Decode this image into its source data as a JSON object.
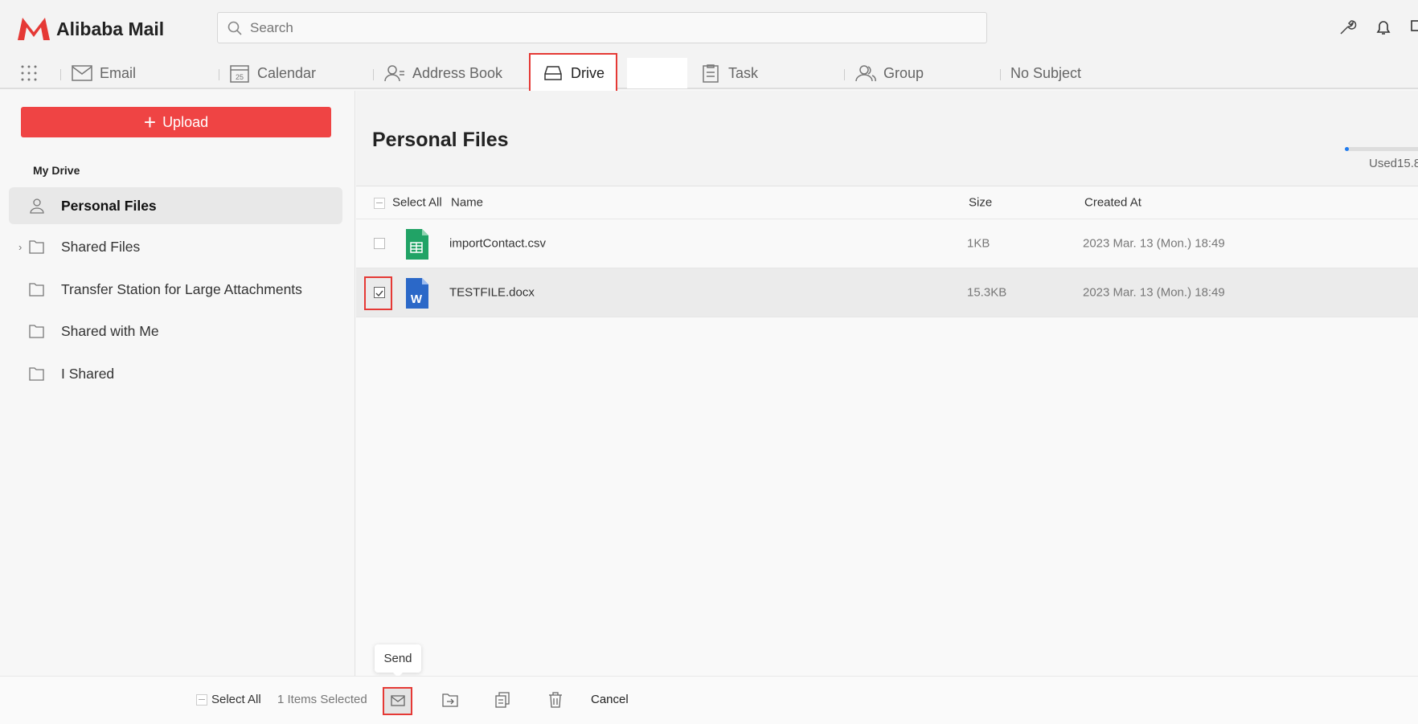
{
  "app": {
    "title": "Alibaba Mail"
  },
  "search": {
    "placeholder": "Search"
  },
  "nav": {
    "tabs": [
      {
        "label": "Email"
      },
      {
        "label": "Calendar",
        "icon_text": "25"
      },
      {
        "label": "Address Book"
      },
      {
        "label": "Drive"
      },
      {
        "label": "Task"
      },
      {
        "label": "Group"
      },
      {
        "label": "No Subject"
      }
    ]
  },
  "sidebar": {
    "upload_label": "Upload",
    "section": "My Drive",
    "items": [
      {
        "label": "Personal Files"
      },
      {
        "label": "Shared Files"
      },
      {
        "label": "Transfer Station for Large Attachments"
      },
      {
        "label": "Shared with Me"
      },
      {
        "label": "I Shared"
      }
    ]
  },
  "main": {
    "title": "Personal Files",
    "usage_text": "Used15.8",
    "usage_fraction": 0.01,
    "columns": {
      "select_all": "Select All",
      "name": "Name",
      "size": "Size",
      "created": "Created At"
    },
    "files": [
      {
        "name": "importContact.csv",
        "size": "1KB",
        "created": "2023 Mar. 13 (Mon.) 18:49",
        "checked": false
      },
      {
        "name": "TESTFILE.docx",
        "size": "15.3KB",
        "created": "2023 Mar. 13 (Mon.) 18:49",
        "checked": true
      }
    ]
  },
  "bottombar": {
    "select_all": "Select All",
    "selected_count": "1 Items Selected",
    "tooltip": "Send",
    "cancel": "Cancel"
  },
  "colors": {
    "accent": "#ef4444",
    "highlight": "#e53935",
    "progress": "#1e7bf0"
  }
}
